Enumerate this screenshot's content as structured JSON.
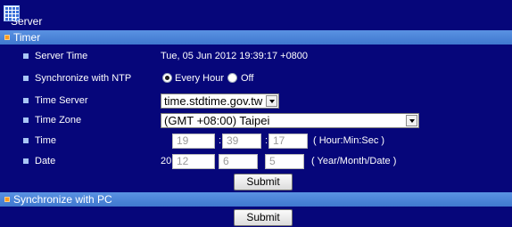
{
  "header": {
    "title": "Server",
    "logo_icon": "grid-logo-icon"
  },
  "timer_section": {
    "title": "Timer",
    "server_time": {
      "label": "Server Time",
      "value": "Tue, 05 Jun 2012 19:39:17 +0800"
    },
    "sync_ntp": {
      "label": "Synchronize with NTP",
      "options": [
        {
          "label": "Every Hour",
          "checked": true
        },
        {
          "label": "Off",
          "checked": false
        }
      ]
    },
    "time_server": {
      "label": "Time Server",
      "value": "time.stdtime.gov.tw"
    },
    "time_zone": {
      "label": "Time Zone",
      "value": "(GMT +08:00) Taipei"
    },
    "time": {
      "label": "Time",
      "hour": "19",
      "minute": "39",
      "second": "17",
      "separator": ":",
      "hint": "( Hour:Min:Sec )"
    },
    "date": {
      "label": "Date",
      "year_prefix": "20",
      "year": "12",
      "month": "6",
      "day": "5",
      "separator": "/",
      "hint": "( Year/Month/Date )"
    },
    "submit_label": "Submit"
  },
  "pc_section": {
    "title": "Synchronize with PC",
    "submit_label": "Submit"
  },
  "colors": {
    "background": "#06067a",
    "section_bar": "#4a84d8",
    "bullet": "#ff9a1f",
    "row_marker": "#a9c6f5"
  }
}
